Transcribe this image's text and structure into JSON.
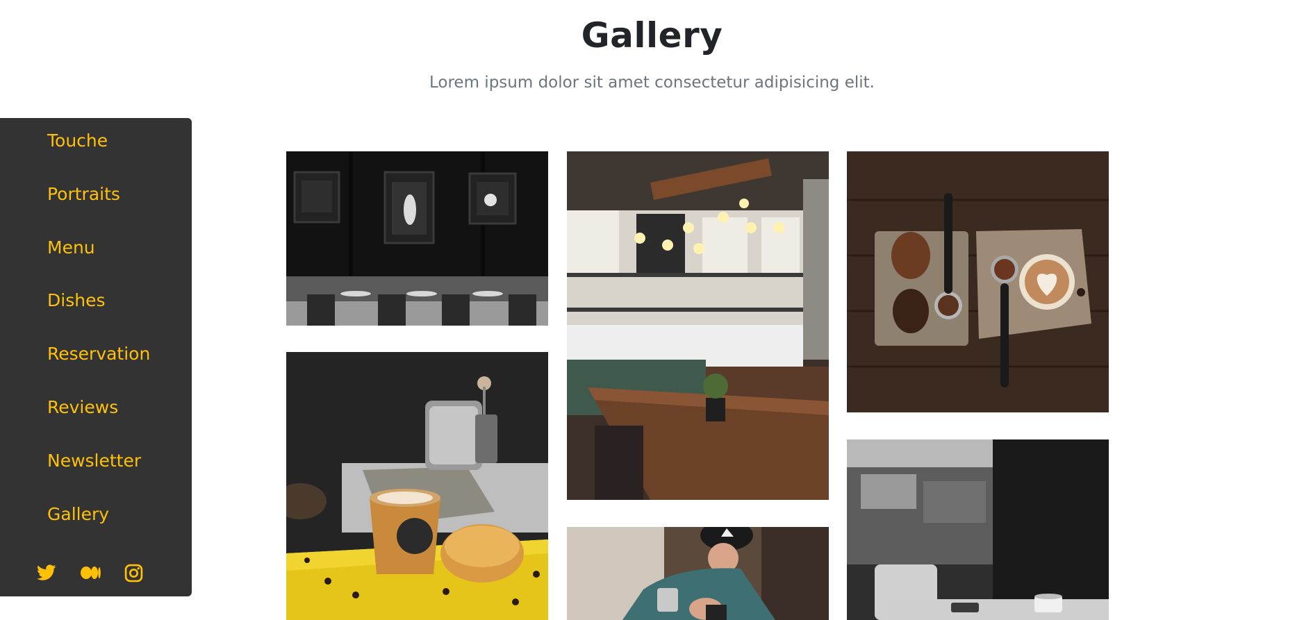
{
  "header": {
    "title": "Gallery",
    "subtitle": "Lorem ipsum dolor sit amet consectetur adipisicing elit."
  },
  "sidebar": {
    "items": [
      {
        "label": "Touche"
      },
      {
        "label": "Portraits"
      },
      {
        "label": "Menu"
      },
      {
        "label": "Dishes"
      },
      {
        "label": "Reservation"
      },
      {
        "label": "Reviews"
      },
      {
        "label": "Newsletter"
      },
      {
        "label": "Gallery"
      }
    ],
    "social": [
      "twitter-icon",
      "medium-icon",
      "instagram-icon"
    ]
  },
  "colors": {
    "accent": "#ffc107",
    "sidebar_bg": "#333333",
    "title": "#212529",
    "subtitle": "#6c757d"
  },
  "gallery": {
    "photos": [
      {
        "subject": "black-and-white-restaurant-interior"
      },
      {
        "subject": "coffee-shop-interior-with-pendant-lights"
      },
      {
        "subject": "coffee-beans-and-latte-on-wooden-board"
      },
      {
        "subject": "latte-cup-and-donut-on-yellow-crate"
      },
      {
        "subject": "barista-pouring-milk"
      },
      {
        "subject": "monochrome-cafe-table-with-cup"
      }
    ]
  }
}
